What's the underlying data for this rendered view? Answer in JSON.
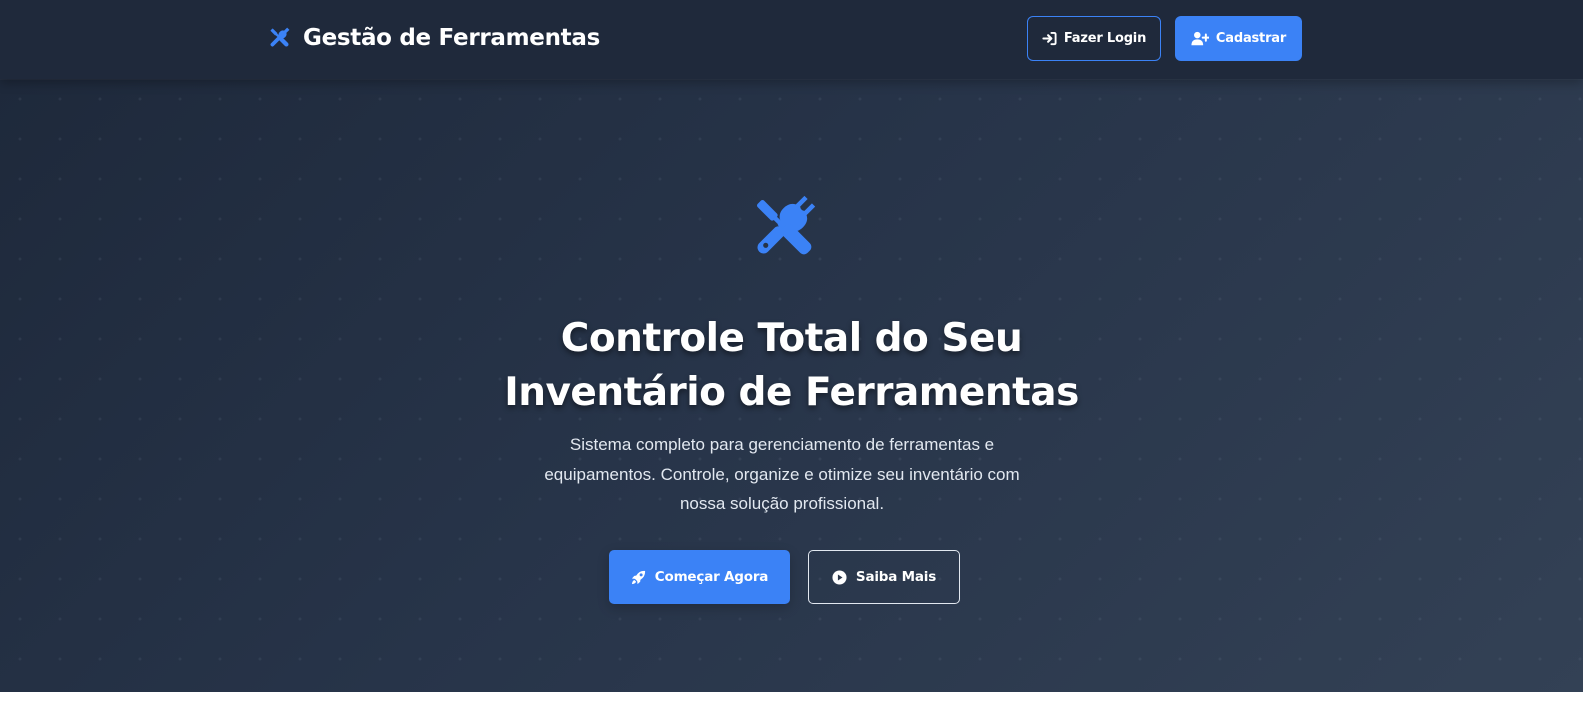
{
  "navbar": {
    "brand_text": "Gestão de Ferramentas",
    "brand_icon": "screwdriver-wrench-icon",
    "login_label": "Fazer Login",
    "login_icon": "sign-in-icon",
    "register_label": "Cadastrar",
    "register_icon": "user-plus-icon"
  },
  "hero": {
    "icon": "screwdriver-wrench-icon",
    "title_line1": "Controle Total do Seu",
    "title_line2": "Inventário de Ferramentas",
    "subtitle": "Sistema completo para gerenciamento de ferramentas e equipamentos. Controle, organize e otimize seu inventário com nossa solução profissional.",
    "primary_label": "Começar Agora",
    "primary_icon": "rocket-icon",
    "secondary_label": "Saiba Mais",
    "secondary_icon": "play-circle-icon"
  },
  "colors": {
    "accent": "#3b82f6",
    "navbar_bg": "#1f293b",
    "hero_bg_start": "#1e293b",
    "hero_bg_end": "#334155",
    "text": "#ffffff"
  }
}
